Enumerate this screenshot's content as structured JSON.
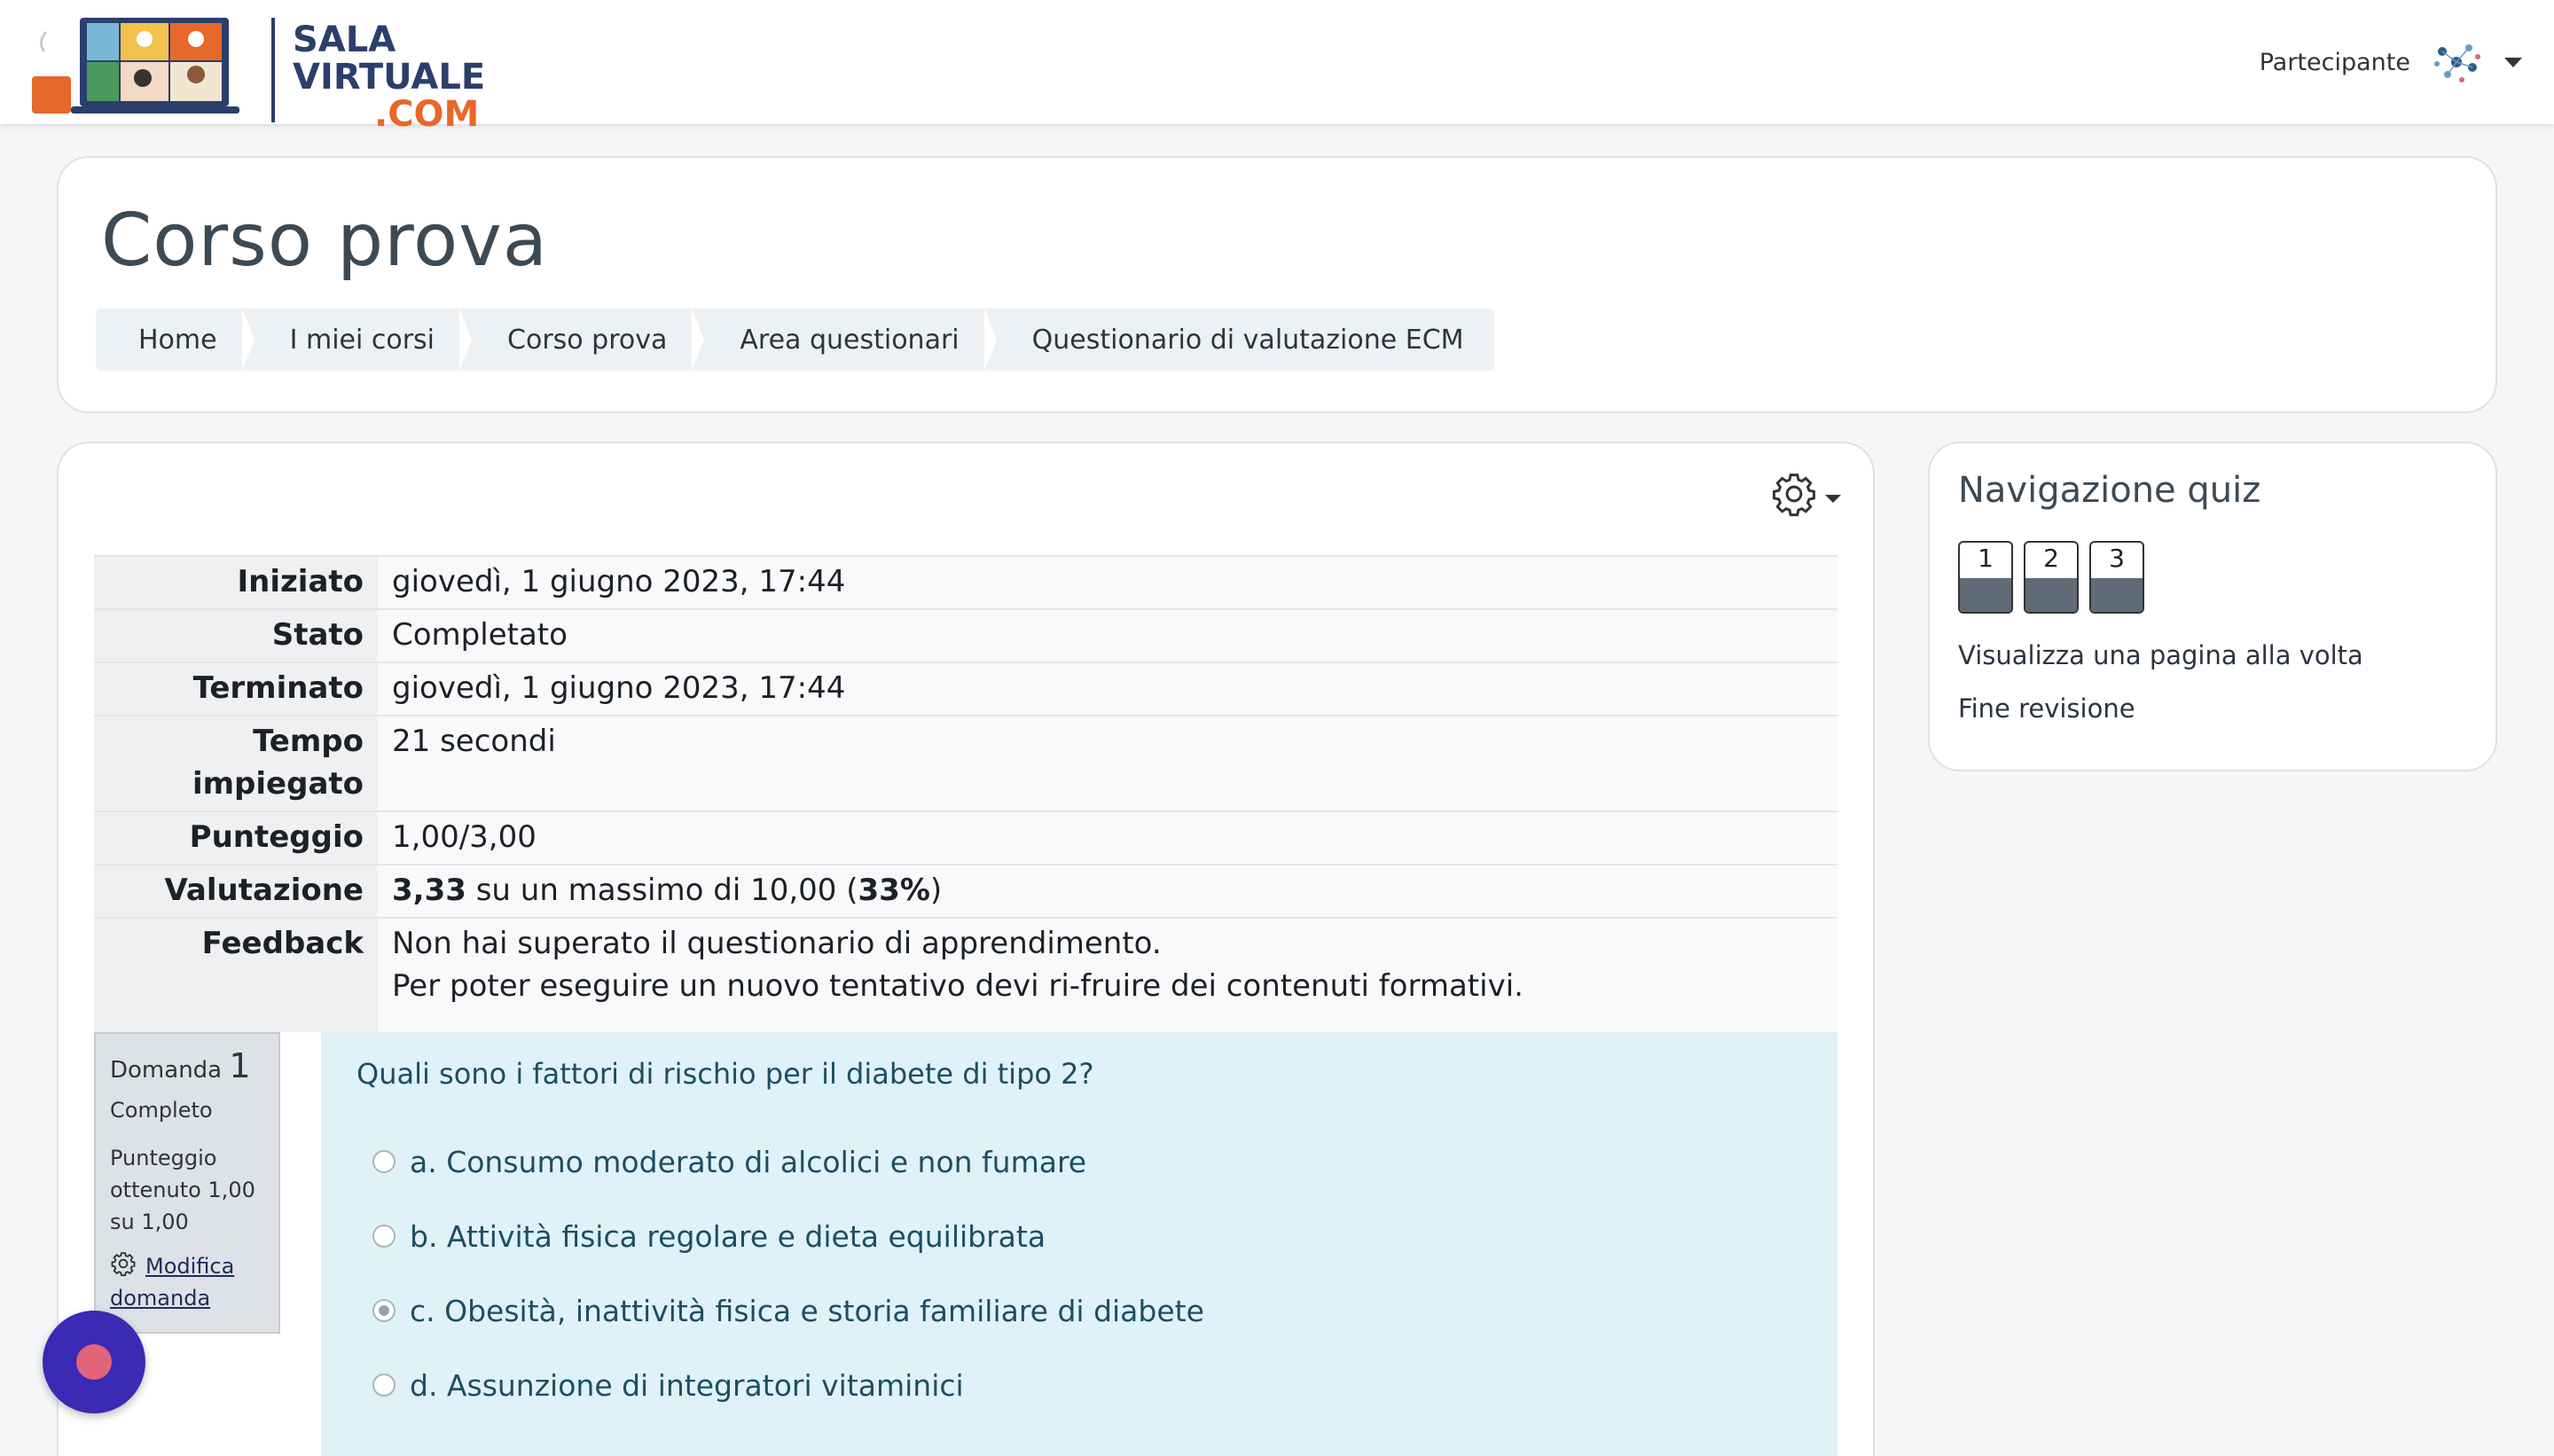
{
  "brand": {
    "line1": "SALA",
    "line2": "VIRTUALE",
    "line3": ".COM",
    "colors": {
      "navy": "#2c3e6b",
      "orange": "#e8672a"
    }
  },
  "user": {
    "role": "Partecipante",
    "avatar_icon": "molecule-avatar-icon",
    "menu_icon": "caret-down-icon"
  },
  "header": {
    "title": "Corso prova",
    "breadcrumb": [
      "Home",
      "I miei corsi",
      "Corso prova",
      "Area questionari",
      "Questionario di valutazione ECM"
    ]
  },
  "summary": {
    "rows": [
      {
        "key": "Iniziato",
        "value": "giovedì, 1 giugno 2023, 17:44"
      },
      {
        "key": "Stato",
        "value": "Completato"
      },
      {
        "key": "Terminato",
        "value": "giovedì, 1 giugno 2023, 17:44"
      },
      {
        "key": "Tempo impiegato",
        "value": "21 secondi"
      },
      {
        "key": "Punteggio",
        "value": "1,00/3,00"
      }
    ],
    "valutazione": {
      "key": "Valutazione",
      "score": "3,33",
      "middle": "su un massimo di 10,00",
      "percent": "33%"
    },
    "feedback": {
      "key": "Feedback",
      "line1": "Non hai superato il questionario di apprendimento.",
      "line2": "Per poter eseguire un nuovo tentativo devi ri-fruire dei contenuti formativi."
    }
  },
  "question": {
    "label": "Domanda",
    "number": "1",
    "state": "Completo",
    "grade": "Punteggio ottenuto 1,00 su 1,00",
    "edit_label": "Modifica domanda",
    "text": "Quali sono i fattori di rischio per il diabete di tipo 2?",
    "answers": [
      {
        "text": "a. Consumo moderato di alcolici e non fumare",
        "checked": false
      },
      {
        "text": "b. Attività fisica regolare e dieta equilibrata",
        "checked": false
      },
      {
        "text": "c. Obesità, inattività fisica e storia familiare di diabete",
        "checked": true
      },
      {
        "text": "d. Assunzione di integratori vitaminici",
        "checked": false
      }
    ]
  },
  "nav": {
    "title": "Navigazione quiz",
    "buttons": [
      "1",
      "2",
      "3"
    ],
    "link1": "Visualizza una pagina alla volta",
    "link2": "Fine revisione"
  },
  "icons": {
    "settings": "gear-icon",
    "chat": "chat-bubble-icon"
  }
}
